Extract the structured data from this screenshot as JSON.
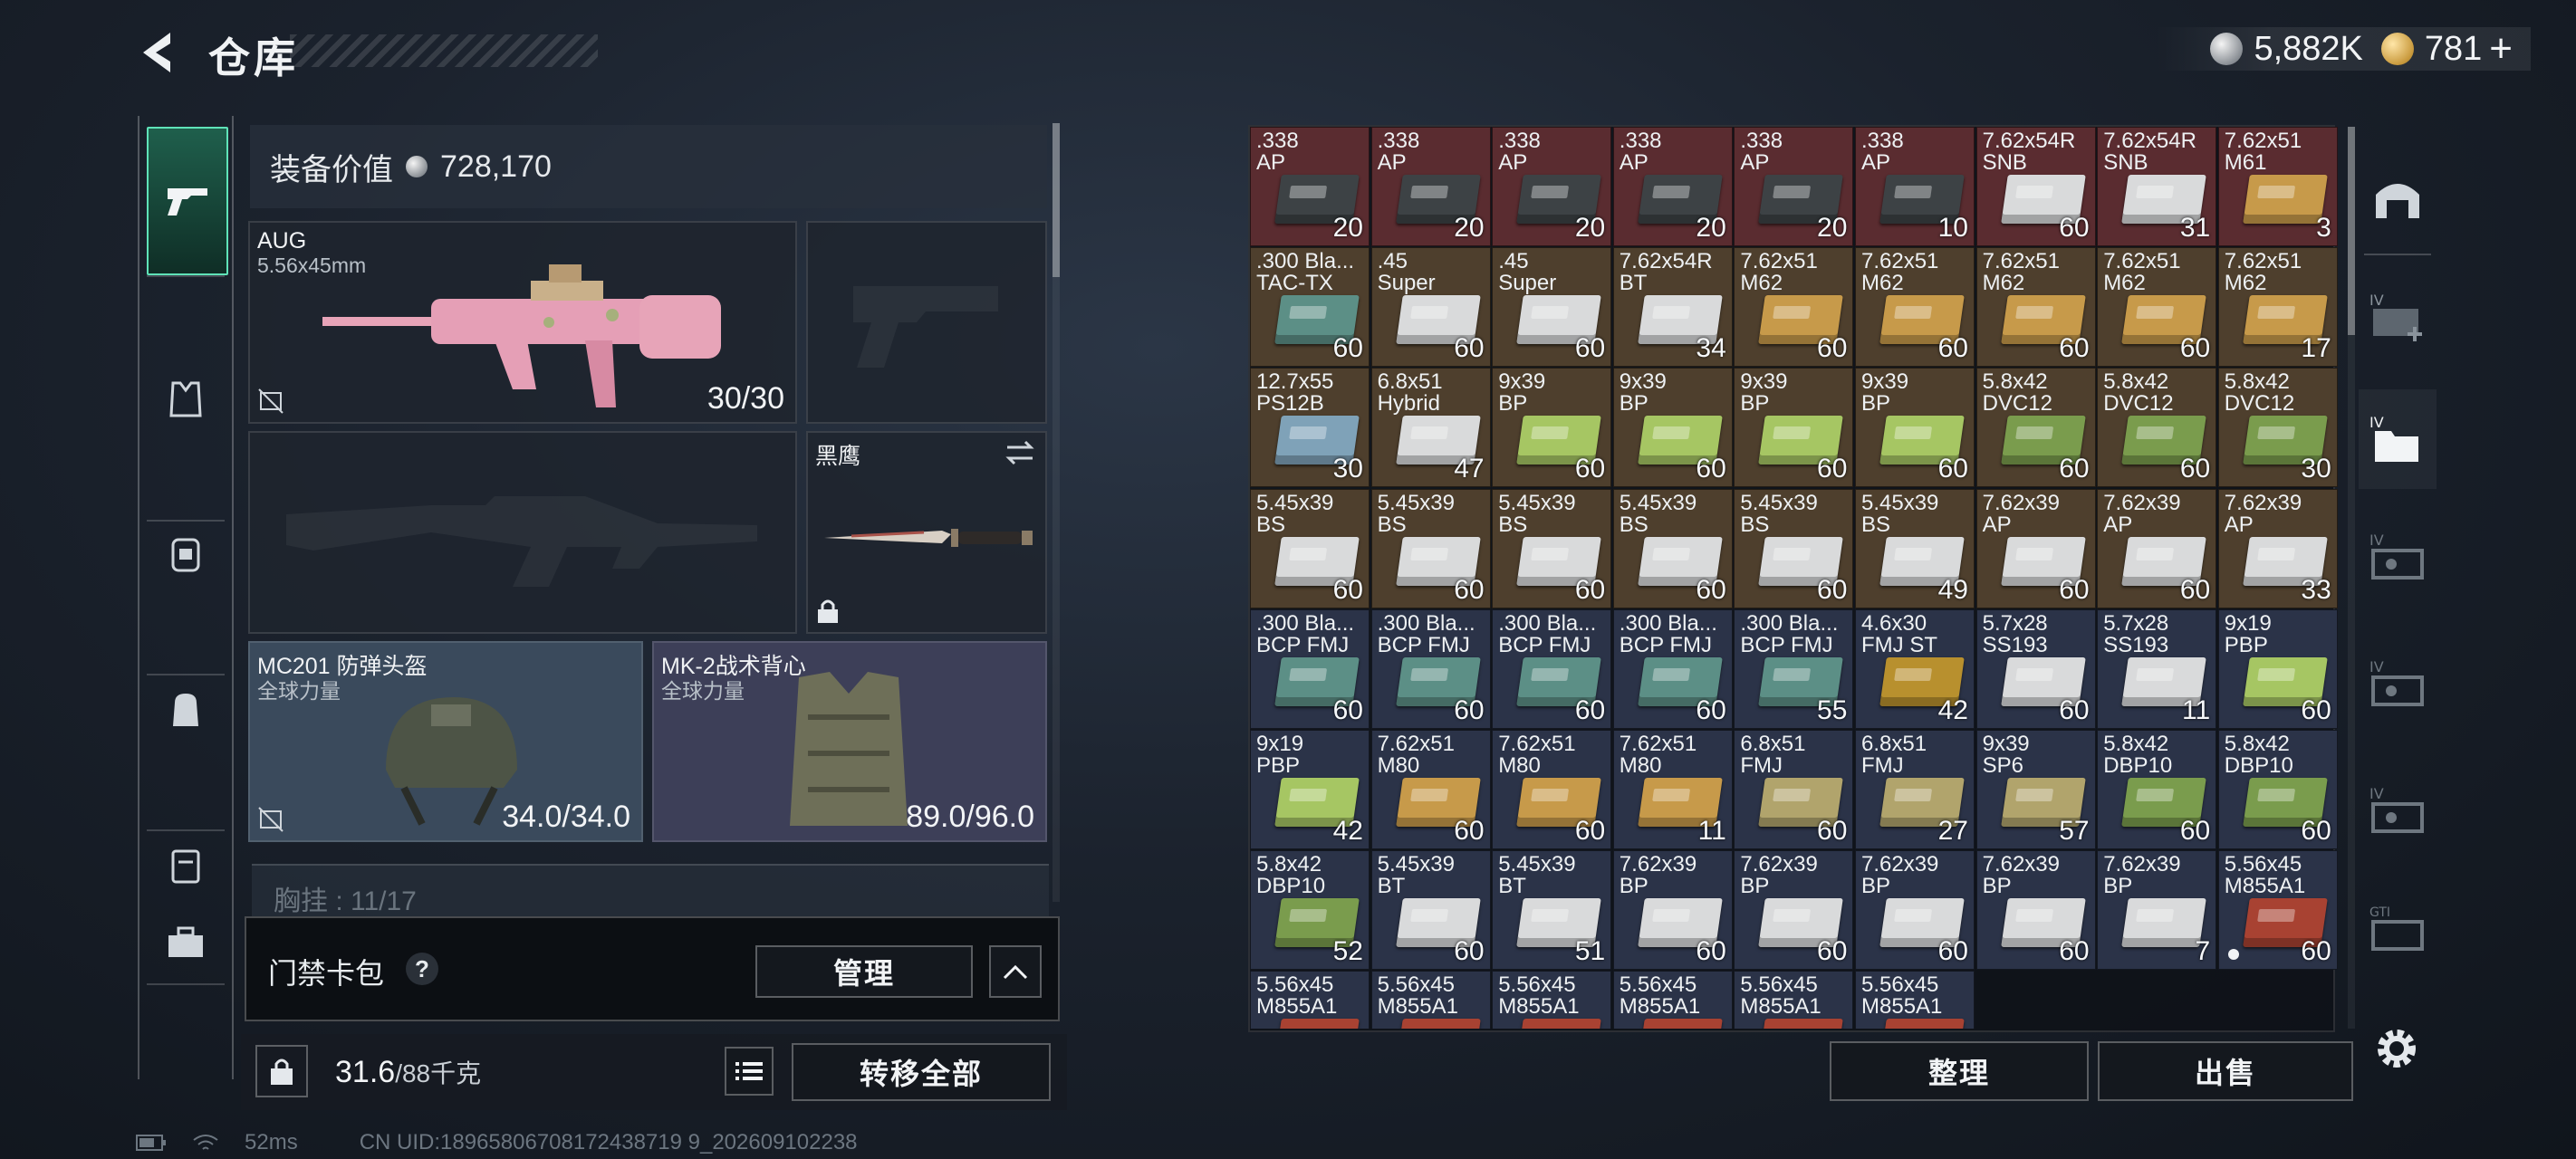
{
  "header": {
    "title": "仓库",
    "currency_1": "5,882K",
    "currency_2": "781",
    "currency_2_plus": "+"
  },
  "nav": {
    "items": [
      "pistol-icon",
      "vest-icon",
      "backpack-id-icon",
      "backpack-icon",
      "case-icon",
      "toolbox-icon"
    ]
  },
  "loadout": {
    "equip_value_label": "装备价值",
    "equip_value": "728,170",
    "primary": {
      "name": "AUG",
      "caliber": "5.56x45mm",
      "ammo": "30/30"
    },
    "knife": {
      "name": "黑鹰"
    },
    "helmet": {
      "name": "MC201 防弹头盔",
      "sub": "全球力量",
      "durability": "34.0/34.0"
    },
    "vest": {
      "name": "MK-2战术背心",
      "sub": "全球力量",
      "durability": "89.0/96.0"
    },
    "chest_rig_partial": "胸挂 : 11/17"
  },
  "cardbar": {
    "label": "门禁卡包",
    "help": "?",
    "manage": "管理"
  },
  "weight": {
    "current": "31.6",
    "max": "/88千克",
    "transfer_all": "转移全部"
  },
  "status": {
    "ping": "52ms",
    "uid": "CN UID:18965806708172438719 9_202609102238"
  },
  "stash_actions": {
    "sort": "整理",
    "sell": "出售"
  },
  "palette": {
    "red": "#5a2c30",
    "brown": "#4e3f2d",
    "navy": "#2b3348",
    "box_white": "#d9dadb",
    "box_yellow": "#c79a4a",
    "box_green": "#7a9c4d",
    "box_teal": "#5c8f86",
    "box_lightgreen": "#a6c663",
    "box_blue": "#7fa2b8",
    "box_olive": "#b1a46c"
  },
  "stash": [
    {
      "l1": ".338",
      "l2": "AP",
      "q": "20",
      "bg": "red",
      "box": "#3d4245"
    },
    {
      "l1": ".338",
      "l2": "AP",
      "q": "20",
      "bg": "red",
      "box": "#3d4245"
    },
    {
      "l1": ".338",
      "l2": "AP",
      "q": "20",
      "bg": "red",
      "box": "#3d4245"
    },
    {
      "l1": ".338",
      "l2": "AP",
      "q": "20",
      "bg": "red",
      "box": "#3d4245"
    },
    {
      "l1": ".338",
      "l2": "AP",
      "q": "20",
      "bg": "red",
      "box": "#3d4245"
    },
    {
      "l1": ".338",
      "l2": "AP",
      "q": "10",
      "bg": "red",
      "box": "#3d4245"
    },
    {
      "l1": "7.62x54R",
      "l2": "SNB",
      "q": "60",
      "bg": "red",
      "box": "#d9dadb"
    },
    {
      "l1": "7.62x54R",
      "l2": "SNB",
      "q": "31",
      "bg": "red",
      "box": "#d9dadb"
    },
    {
      "l1": "7.62x51",
      "l2": "M61",
      "q": "3",
      "bg": "red",
      "box": "#c79a4a"
    },
    {
      "l1": ".300 Bla...",
      "l2": "TAC-TX",
      "q": "60",
      "bg": "brown",
      "box": "#5c8f86"
    },
    {
      "l1": ".45",
      "l2": "Super",
      "q": "60",
      "bg": "brown",
      "box": "#d9dadb"
    },
    {
      "l1": ".45",
      "l2": "Super",
      "q": "60",
      "bg": "brown",
      "box": "#d9dadb"
    },
    {
      "l1": "7.62x54R",
      "l2": "BT",
      "q": "34",
      "bg": "brown",
      "box": "#d9dadb"
    },
    {
      "l1": "7.62x51",
      "l2": "M62",
      "q": "60",
      "bg": "brown",
      "box": "#c79a4a"
    },
    {
      "l1": "7.62x51",
      "l2": "M62",
      "q": "60",
      "bg": "brown",
      "box": "#c79a4a"
    },
    {
      "l1": "7.62x51",
      "l2": "M62",
      "q": "60",
      "bg": "brown",
      "box": "#c79a4a"
    },
    {
      "l1": "7.62x51",
      "l2": "M62",
      "q": "60",
      "bg": "brown",
      "box": "#c79a4a"
    },
    {
      "l1": "7.62x51",
      "l2": "M62",
      "q": "17",
      "bg": "brown",
      "box": "#c79a4a"
    },
    {
      "l1": "12.7x55",
      "l2": "PS12B",
      "q": "30",
      "bg": "brown",
      "box": "#7fa2b8"
    },
    {
      "l1": "6.8x51",
      "l2": "Hybrid",
      "q": "47",
      "bg": "brown",
      "box": "#d9dadb"
    },
    {
      "l1": "9x39",
      "l2": "BP",
      "q": "60",
      "bg": "brown",
      "box": "#a6c663"
    },
    {
      "l1": "9x39",
      "l2": "BP",
      "q": "60",
      "bg": "brown",
      "box": "#a6c663"
    },
    {
      "l1": "9x39",
      "l2": "BP",
      "q": "60",
      "bg": "brown",
      "box": "#a6c663"
    },
    {
      "l1": "9x39",
      "l2": "BP",
      "q": "60",
      "bg": "brown",
      "box": "#a6c663"
    },
    {
      "l1": "5.8x42",
      "l2": "DVC12",
      "q": "60",
      "bg": "brown",
      "box": "#7a9c4d"
    },
    {
      "l1": "5.8x42",
      "l2": "DVC12",
      "q": "60",
      "bg": "brown",
      "box": "#7a9c4d"
    },
    {
      "l1": "5.8x42",
      "l2": "DVC12",
      "q": "30",
      "bg": "brown",
      "box": "#7a9c4d"
    },
    {
      "l1": "5.45x39",
      "l2": "BS",
      "q": "60",
      "bg": "brown",
      "box": "#d9dadb"
    },
    {
      "l1": "5.45x39",
      "l2": "BS",
      "q": "60",
      "bg": "brown",
      "box": "#d9dadb"
    },
    {
      "l1": "5.45x39",
      "l2": "BS",
      "q": "60",
      "bg": "brown",
      "box": "#d9dadb"
    },
    {
      "l1": "5.45x39",
      "l2": "BS",
      "q": "60",
      "bg": "brown",
      "box": "#d9dadb"
    },
    {
      "l1": "5.45x39",
      "l2": "BS",
      "q": "60",
      "bg": "brown",
      "box": "#d9dadb"
    },
    {
      "l1": "5.45x39",
      "l2": "BS",
      "q": "49",
      "bg": "brown",
      "box": "#d9dadb"
    },
    {
      "l1": "7.62x39",
      "l2": "AP",
      "q": "60",
      "bg": "brown",
      "box": "#d9dadb"
    },
    {
      "l1": "7.62x39",
      "l2": "AP",
      "q": "60",
      "bg": "brown",
      "box": "#d9dadb"
    },
    {
      "l1": "7.62x39",
      "l2": "AP",
      "q": "33",
      "bg": "brown",
      "box": "#d9dadb"
    },
    {
      "l1": ".300 Bla...",
      "l2": "BCP FMJ",
      "q": "60",
      "bg": "navy",
      "box": "#5c8f86"
    },
    {
      "l1": ".300 Bla...",
      "l2": "BCP FMJ",
      "q": "60",
      "bg": "navy",
      "box": "#5c8f86"
    },
    {
      "l1": ".300 Bla...",
      "l2": "BCP FMJ",
      "q": "60",
      "bg": "navy",
      "box": "#5c8f86"
    },
    {
      "l1": ".300 Bla...",
      "l2": "BCP FMJ",
      "q": "60",
      "bg": "navy",
      "box": "#5c8f86"
    },
    {
      "l1": ".300 Bla...",
      "l2": "BCP FMJ",
      "q": "55",
      "bg": "navy",
      "box": "#5c8f86"
    },
    {
      "l1": "4.6x30",
      "l2": "FMJ ST",
      "q": "42",
      "bg": "navy",
      "box": "#b8902e"
    },
    {
      "l1": "5.7x28",
      "l2": "SS193",
      "q": "60",
      "bg": "navy",
      "box": "#d9dadb"
    },
    {
      "l1": "5.7x28",
      "l2": "SS193",
      "q": "11",
      "bg": "navy",
      "box": "#d9dadb"
    },
    {
      "l1": "9x19",
      "l2": "PBP",
      "q": "60",
      "bg": "navy",
      "box": "#a6c663"
    },
    {
      "l1": "9x19",
      "l2": "PBP",
      "q": "42",
      "bg": "navy",
      "box": "#a6c663"
    },
    {
      "l1": "7.62x51",
      "l2": "M80",
      "q": "60",
      "bg": "navy",
      "box": "#c79a4a"
    },
    {
      "l1": "7.62x51",
      "l2": "M80",
      "q": "60",
      "bg": "navy",
      "box": "#c79a4a"
    },
    {
      "l1": "7.62x51",
      "l2": "M80",
      "q": "11",
      "bg": "navy",
      "box": "#c79a4a"
    },
    {
      "l1": "6.8x51",
      "l2": "FMJ",
      "q": "60",
      "bg": "navy",
      "box": "#b1a46c"
    },
    {
      "l1": "6.8x51",
      "l2": "FMJ",
      "q": "27",
      "bg": "navy",
      "box": "#b1a46c"
    },
    {
      "l1": "9x39",
      "l2": "SP6",
      "q": "57",
      "bg": "navy",
      "box": "#b1a46c"
    },
    {
      "l1": "5.8x42",
      "l2": "DBP10",
      "q": "60",
      "bg": "navy",
      "box": "#7a9c4d"
    },
    {
      "l1": "5.8x42",
      "l2": "DBP10",
      "q": "60",
      "bg": "navy",
      "box": "#7a9c4d"
    },
    {
      "l1": "5.8x42",
      "l2": "DBP10",
      "q": "52",
      "bg": "navy",
      "box": "#7a9c4d"
    },
    {
      "l1": "5.45x39",
      "l2": "BT",
      "q": "60",
      "bg": "navy",
      "box": "#d9dadb"
    },
    {
      "l1": "5.45x39",
      "l2": "BT",
      "q": "51",
      "bg": "navy",
      "box": "#d9dadb"
    },
    {
      "l1": "7.62x39",
      "l2": "BP",
      "q": "60",
      "bg": "navy",
      "box": "#d9dadb"
    },
    {
      "l1": "7.62x39",
      "l2": "BP",
      "q": "60",
      "bg": "navy",
      "box": "#d9dadb"
    },
    {
      "l1": "7.62x39",
      "l2": "BP",
      "q": "60",
      "bg": "navy",
      "box": "#d9dadb"
    },
    {
      "l1": "7.62x39",
      "l2": "BP",
      "q": "60",
      "bg": "navy",
      "box": "#d9dadb"
    },
    {
      "l1": "7.62x39",
      "l2": "BP",
      "q": "7",
      "bg": "navy",
      "box": "#d9dadb"
    },
    {
      "l1": "5.56x45",
      "l2": "M855A1",
      "q": "60",
      "bg": "navy",
      "box": "#a84232",
      "dot": true
    },
    {
      "l1": "5.56x45",
      "l2": "M855A1",
      "q": "",
      "bg": "navy",
      "box": "#a84232"
    },
    {
      "l1": "5.56x45",
      "l2": "M855A1",
      "q": "",
      "bg": "navy",
      "box": "#a84232"
    },
    {
      "l1": "5.56x45",
      "l2": "M855A1",
      "q": "",
      "bg": "navy",
      "box": "#a84232"
    },
    {
      "l1": "5.56x45",
      "l2": "M855A1",
      "q": "",
      "bg": "navy",
      "box": "#a84232"
    },
    {
      "l1": "5.56x45",
      "l2": "M855A1",
      "q": "",
      "bg": "navy",
      "box": "#a84232"
    },
    {
      "l1": "5.56x45",
      "l2": "M855A1",
      "q": "",
      "bg": "navy",
      "box": "#a84232"
    }
  ]
}
